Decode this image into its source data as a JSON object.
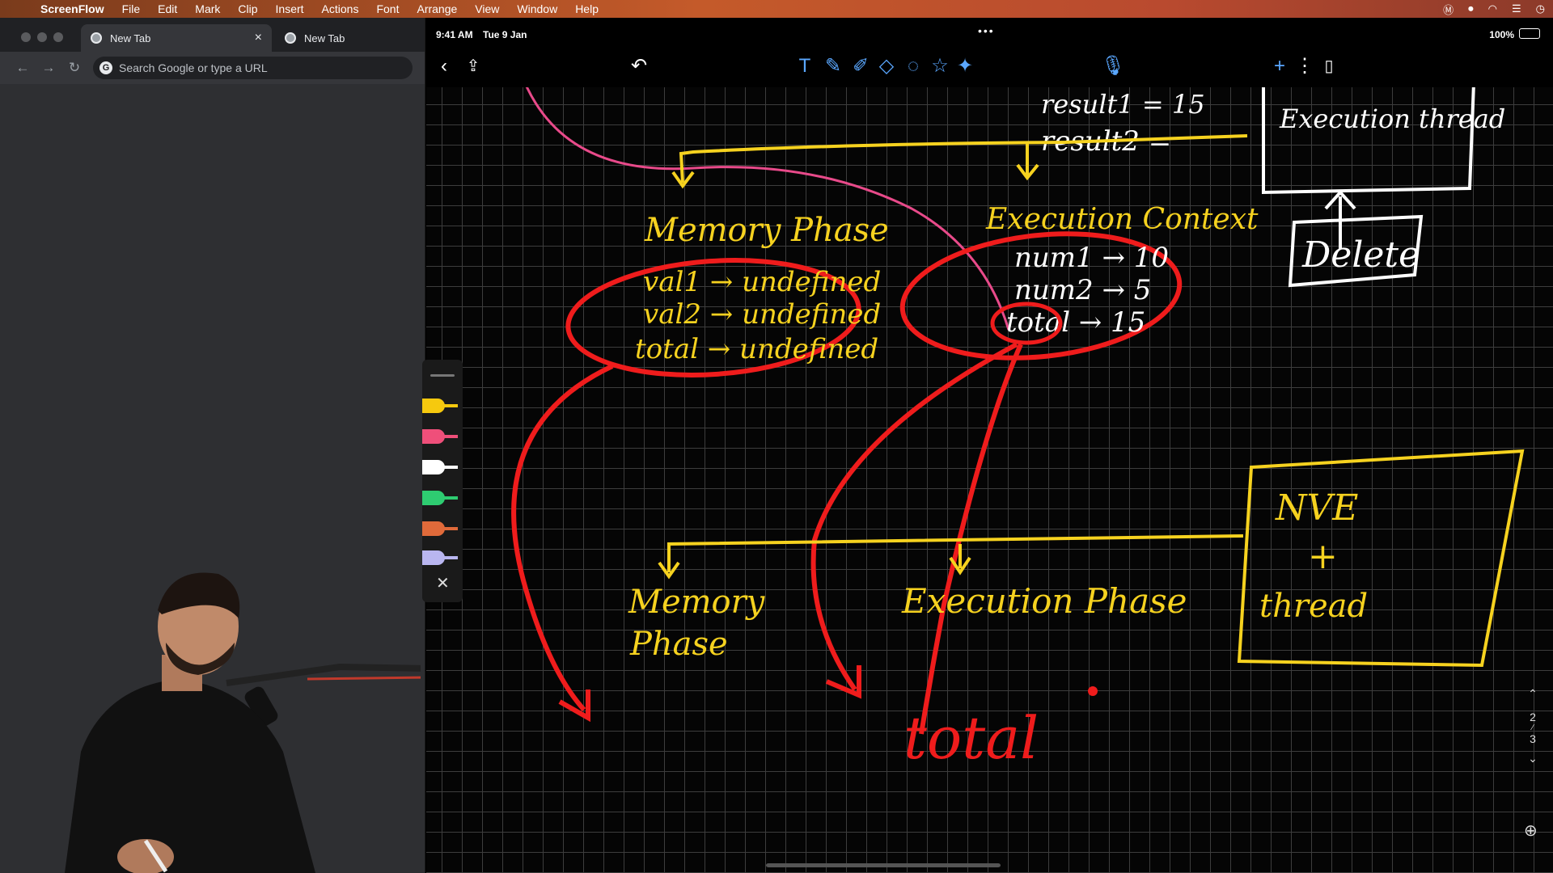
{
  "menubar": {
    "app_name": "ScreenFlow",
    "items": [
      "File",
      "Edit",
      "Mark",
      "Clip",
      "Insert",
      "Actions",
      "Font",
      "Arrange",
      "View",
      "Window",
      "Help"
    ]
  },
  "browser": {
    "tabs": [
      {
        "label": "New Tab",
        "close": "×"
      },
      {
        "label": "New Tab"
      }
    ],
    "omnibox_placeholder": "Search Google or type a URL",
    "omnibox_icon": "G"
  },
  "ipad": {
    "time": "9:41 AM",
    "date": "Tue 9 Jan",
    "dots": "•••",
    "battery": "100%",
    "toolbar_icons": [
      "back-icon",
      "share-icon",
      "undo-icon",
      "text-tool-icon",
      "pen-icon",
      "highlighter-icon",
      "eraser-icon",
      "lasso-icon",
      "shape-icon",
      "laser-pointer-icon",
      "microphone-icon",
      "add-page-icon",
      "more-icon",
      "pages-icon"
    ]
  },
  "pen_colors": [
    "#f6c90e",
    "#ef4f7a",
    "#ffffff",
    "#2ecc71",
    "#e06a3a",
    "#b9b6f0"
  ],
  "notes": {
    "top_partial": "result1 = 15",
    "result2": "result2 =",
    "execution_thread_box": "Execution thread",
    "delete_box": "Delete",
    "memory_phase_title": "Memory Phase",
    "memory_rows": [
      "val1 → undefined",
      "val2 → undefined",
      "total → undefined"
    ],
    "execution_context_title": "Execution Context",
    "context_rows": [
      "num1 → 10",
      "num2 → 5",
      "total → 15"
    ],
    "nve_box_line1": "NVE",
    "nve_box_plus": "+",
    "nve_box_line3": "thread",
    "memory_phase_lower": [
      "Memory",
      "Phase"
    ],
    "execution_phase_lower": "Execution Phase",
    "bottom_word": "total",
    "colors": {
      "yellow": "#f6d21f",
      "red": "#ef1c1c",
      "pink": "#e84a8a",
      "white": "#ffffff"
    }
  },
  "page_nav": {
    "current": "2",
    "total": "3"
  }
}
